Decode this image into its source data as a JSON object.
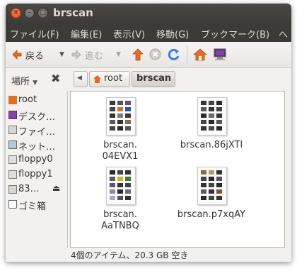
{
  "window": {
    "title": "brscan"
  },
  "window_buttons": {
    "close": "×",
    "minimize": "–",
    "maximize": "□"
  },
  "menu": [
    "ファイル(F)",
    "編集(E)",
    "表示(V)",
    "移動(G)",
    "ブックマーク(B)",
    "へ"
  ],
  "toolbar": {
    "back": "戻る",
    "forward": "進む"
  },
  "pathbar": {
    "places_label": "場所",
    "crumbs": [
      "root",
      "brscan"
    ]
  },
  "sidebar": {
    "items": [
      {
        "label": "root",
        "icon": "home-folder-icon"
      },
      {
        "label": "デスク…",
        "icon": "desktop-icon"
      },
      {
        "label": "ファイ…",
        "icon": "drive-icon"
      },
      {
        "label": "ネット…",
        "icon": "network-icon"
      },
      {
        "label": "floppy0",
        "icon": "floppy-icon"
      },
      {
        "label": "floppy1",
        "icon": "floppy-icon"
      },
      {
        "label": "83…",
        "icon": "drive-icon"
      },
      {
        "label": "ゴミ箱",
        "icon": "trash-icon"
      }
    ]
  },
  "files": [
    {
      "line1": "brscan.",
      "line2": "04EVX1"
    },
    {
      "line1": "brscan.86jXTl",
      "line2": ""
    },
    {
      "line1": "brscan.",
      "line2": "AaTNBQ"
    },
    {
      "line1": "brscan.p7xqAY",
      "line2": ""
    }
  ],
  "status": {
    "text": "4個のアイテム、20.3 GB 空き"
  },
  "colors": {
    "titlebar": "#3c3b37",
    "close": "#df4a16",
    "accent_orange": "#e46d1f",
    "reload_blue": "#3a7fd6"
  }
}
